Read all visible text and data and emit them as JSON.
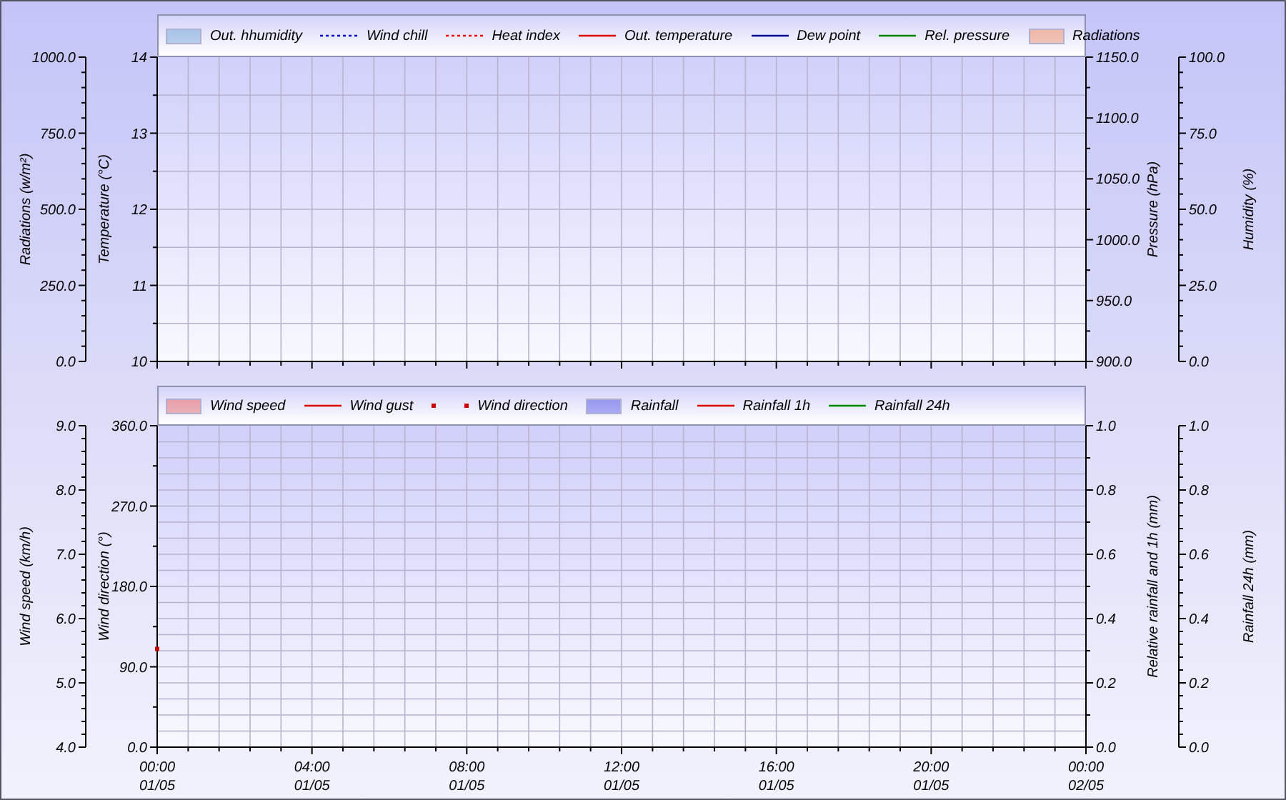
{
  "top_panel": {
    "grid": true,
    "legend": [
      {
        "label": "Out. hhumidity",
        "kind": "area",
        "color": "#a8c4e8"
      },
      {
        "label": "Wind chill",
        "kind": "dotted",
        "color": "#0000cc"
      },
      {
        "label": "Heat index",
        "kind": "dotted",
        "color": "#ff0000"
      },
      {
        "label": "Out. temperature",
        "kind": "line",
        "color": "#dd0000"
      },
      {
        "label": "Dew point",
        "kind": "line",
        "color": "#000099"
      },
      {
        "label": "Rel. pressure",
        "kind": "line",
        "color": "#008800"
      },
      {
        "label": "Radiations",
        "kind": "area",
        "color": "#f0b8a8"
      }
    ],
    "axes": [
      {
        "title": "Radiations (w/m²)",
        "ticks": [
          "1000.0",
          "750.0",
          "500.0",
          "250.0",
          "0.0"
        ]
      },
      {
        "title": "Temperature (°C)",
        "ticks": [
          "14",
          "13",
          "12",
          "11",
          "10"
        ]
      },
      {
        "title": "Pressure (hPa)",
        "ticks": [
          "1150.0",
          "1100.0",
          "1050.0",
          "1000.0",
          "950.0",
          "900.0"
        ]
      },
      {
        "title": "Humidity (%)",
        "ticks": [
          "100.0",
          "75.0",
          "50.0",
          "25.0",
          "0.0"
        ]
      }
    ]
  },
  "bottom_panel": {
    "legend": [
      {
        "label": "Wind speed",
        "kind": "area",
        "color": "#e8a0a8"
      },
      {
        "label": "Wind gust",
        "kind": "line",
        "color": "#dd0000"
      },
      {
        "label": "Wind direction",
        "kind": "points",
        "color": "#cc0000"
      },
      {
        "label": "Rainfall",
        "kind": "area",
        "color": "#9898f0"
      },
      {
        "label": "Rainfall 1h",
        "kind": "line",
        "color": "#dd0000"
      },
      {
        "label": "Rainfall 24h",
        "kind": "line",
        "color": "#008800"
      }
    ],
    "axes": [
      {
        "title": "Wind speed (km/h)",
        "ticks": [
          "9.0",
          "8.0",
          "7.0",
          "6.0",
          "5.0",
          "4.0"
        ]
      },
      {
        "title": "Wind direction (°)"
      },
      {
        "title": "Relative rainfall and 1h (mm)",
        "ticks": [
          "1.0",
          "0.8",
          "0.6",
          "0.4",
          "0.2",
          "0.0"
        ]
      },
      {
        "title": "Rainfall 24h (mm)",
        "ticks": [
          "1.0",
          "0.8",
          "0.6",
          "0.4",
          "0.2",
          "0.0"
        ]
      }
    ],
    "x_dates": [
      "01/05",
      "01/05",
      "01/05",
      "01/05",
      "01/05",
      "01/05",
      "02/05"
    ],
    "chart_data": {
      "type": "scatter",
      "grid": true,
      "x": [
        0
      ],
      "xlim": [
        0,
        24
      ],
      "ylim": [
        0,
        360
      ],
      "xticks": [
        {
          "value": 0,
          "label": "00:00"
        },
        {
          "value": 4,
          "label": "04:00"
        },
        {
          "value": 8,
          "label": "08:00"
        },
        {
          "value": 12,
          "label": "12:00"
        },
        {
          "value": 16,
          "label": "16:00"
        },
        {
          "value": 20,
          "label": "20:00"
        },
        {
          "value": 24,
          "label": "00:00"
        }
      ],
      "yticks": [
        {
          "value": 360,
          "label": "360.0"
        },
        {
          "value": 270,
          "label": "270.0"
        },
        {
          "value": 180,
          "label": "180.0"
        },
        {
          "value": 90,
          "label": "90.0"
        },
        {
          "value": 0,
          "label": "0.0"
        }
      ],
      "series": [
        {
          "color": "#cc0000",
          "values": [
            110
          ]
        }
      ]
    }
  }
}
